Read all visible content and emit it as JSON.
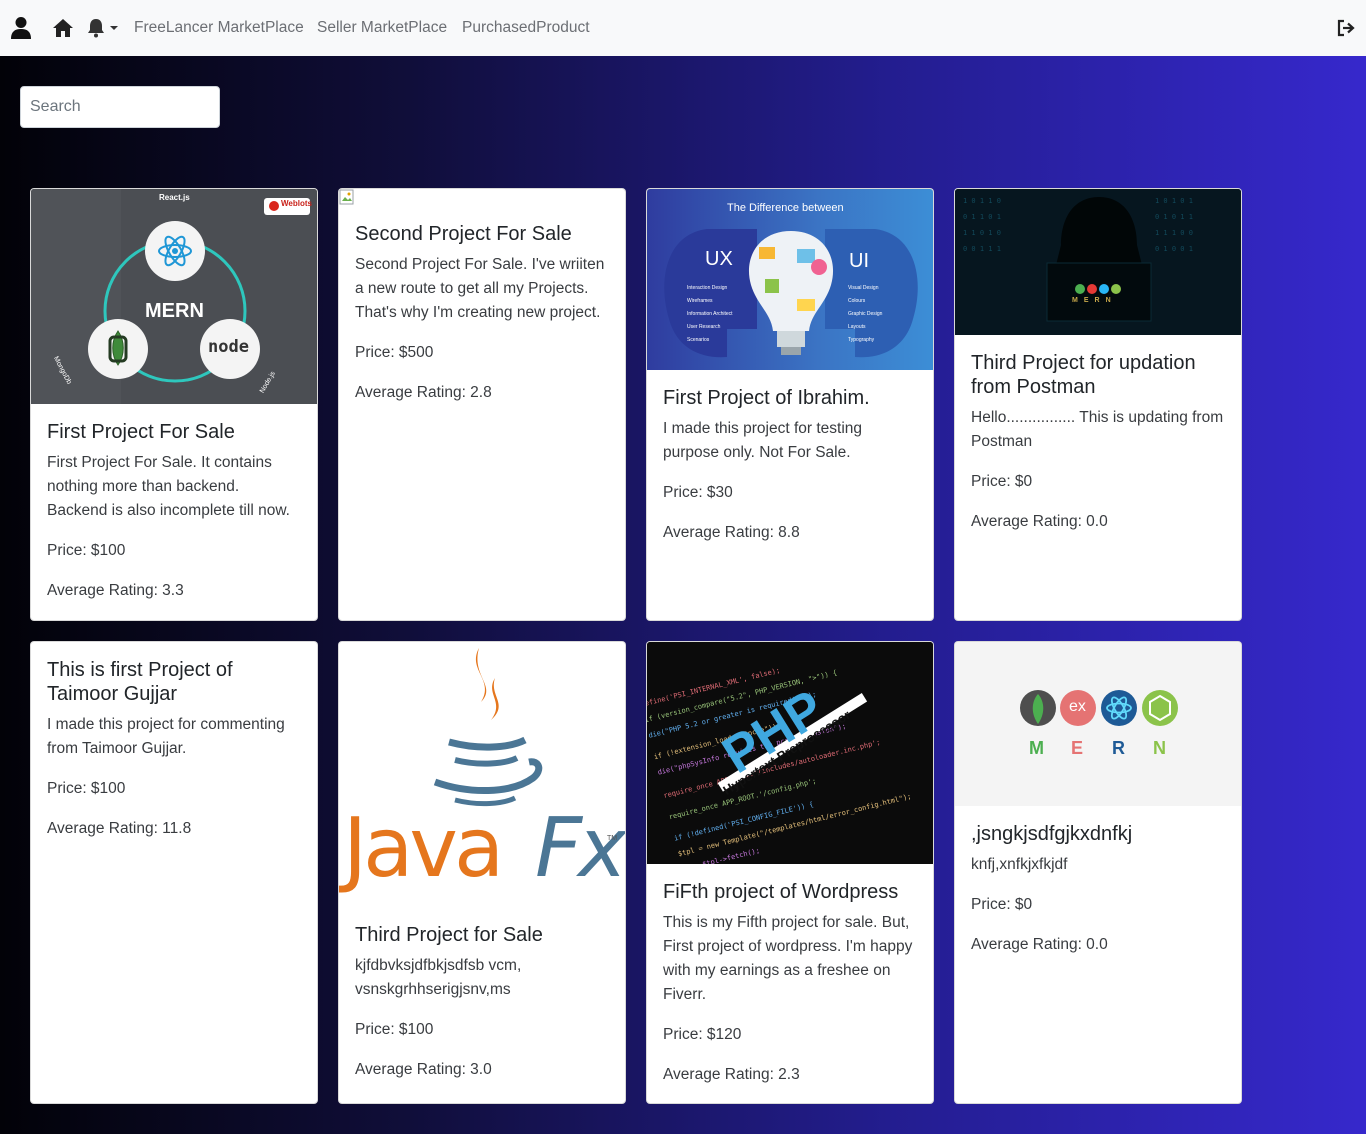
{
  "nav": {
    "links": [
      "FreeLancer MarketPlace",
      "Seller MarketPlace",
      "PurchasedProduct"
    ]
  },
  "search": {
    "placeholder": "Search"
  },
  "image_text": {
    "mern1": {
      "react": "React.js",
      "brand": "Weblots",
      "center": "MERN",
      "mongo": "MongoDb",
      "node": "Node.js",
      "node_logo": "node"
    },
    "uxui": {
      "heading": "The Difference between",
      "ux": "UX",
      "ui": "UI",
      "ux_items": [
        "Interaction Design",
        "Wireframes",
        "Information Architect",
        "User Research",
        "Scenarios"
      ],
      "ui_items": [
        "Visual Design",
        "Colours",
        "Graphic Design",
        "Layouts",
        "Typography"
      ]
    },
    "mern2": {
      "letters": [
        "M",
        "E",
        "R",
        "N"
      ]
    },
    "javafx": {
      "java": "Java",
      "fx": "Fx",
      "tm": "TM"
    },
    "php": {
      "logo": "PHP",
      "tagline": "Hypertext Preprocessor"
    },
    "mern3": {
      "letters": [
        "M",
        "E",
        "R",
        "N"
      ]
    }
  },
  "cards": [
    {
      "title": "First Project For Sale",
      "description": "First Project For Sale. It contains nothing more than backend. Backend is also incomplete till now.",
      "price": "Price: $100",
      "rating": "Average Rating: 3.3"
    },
    {
      "title": "Second Project For Sale",
      "description": "Second Project For Sale. I've wriiten a new route to get all my Projects. That's why I'm creating new project.",
      "price": "Price: $500",
      "rating": "Average Rating: 2.8"
    },
    {
      "title": "First Project of Ibrahim.",
      "description": "I made this project for testing purpose only. Not For Sale.",
      "price": "Price: $30",
      "rating": "Average Rating: 8.8"
    },
    {
      "title": "Third Project for updation from Postman",
      "description": "Hello................ This is updating from Postman",
      "price": "Price: $0",
      "rating": "Average Rating: 0.0"
    },
    {
      "title": "This is first Project of Taimoor Gujjar",
      "description": "I made this project for commenting from Taimoor Gujjar.",
      "price": "Price: $100",
      "rating": "Average Rating: 11.8"
    },
    {
      "title": "Third Project for Sale",
      "description": "kjfdbvksjdfbkjsdfsb vcm, vsnskgrhhserigjsnv,ms",
      "price": "Price: $100",
      "rating": "Average Rating: 3.0"
    },
    {
      "title": "FiFth project of Wordpress",
      "description": "This is my Fifth project for sale. But, First project of wordpress. I'm happy with my earnings as a freshee on Fiverr.",
      "price": "Price: $120",
      "rating": "Average Rating: 2.3"
    },
    {
      "title": ",jsngkjsdfgjkxdnfkj",
      "description": "knfj,xnfkjxfkjdf",
      "price": "Price: $0",
      "rating": "Average Rating: 0.0"
    }
  ],
  "colors": {
    "navbar_bg": "#f8f9fa",
    "nav_link": "#6c6f74",
    "page_gradient": [
      "#020208",
      "#3628cc"
    ],
    "card_bg": "#ffffff"
  },
  "icons": [
    "user-icon",
    "home-icon",
    "bell-icon",
    "caret-down-icon",
    "logout-icon",
    "broken-image-icon"
  ]
}
